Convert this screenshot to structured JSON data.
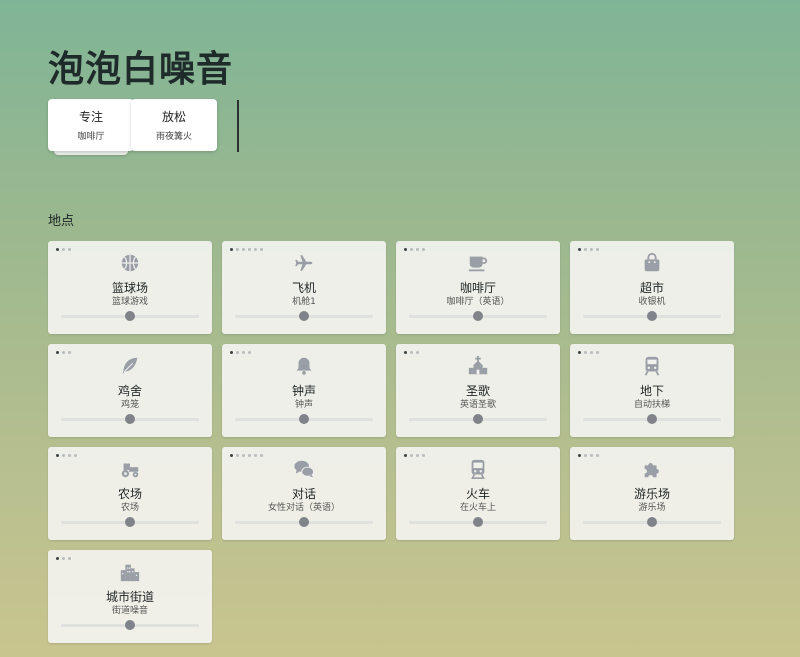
{
  "app": {
    "title": "泡泡白噪音"
  },
  "presets": [
    {
      "label": "专注",
      "sub": "咖啡厅"
    },
    {
      "label": "放松",
      "sub": "雨夜篝火"
    }
  ],
  "section": {
    "label": "地点"
  },
  "cards": [
    {
      "name": "篮球场",
      "sub": "篮球游戏",
      "icon": "basketball-icon",
      "dots": 3,
      "active_dot": 0,
      "volume": 0.5
    },
    {
      "name": "飞机",
      "sub": "机舱1",
      "icon": "airplane-icon",
      "dots": 6,
      "active_dot": 0,
      "volume": 0.5
    },
    {
      "name": "咖啡厅",
      "sub": "咖啡厅（英语）",
      "icon": "coffee-icon",
      "dots": 4,
      "active_dot": 0,
      "volume": 0.5
    },
    {
      "name": "超市",
      "sub": "收银机",
      "icon": "shopping-bag-icon",
      "dots": 4,
      "active_dot": 0,
      "volume": 0.5
    },
    {
      "name": "鸡舍",
      "sub": "鸡笼",
      "icon": "feather-icon",
      "dots": 3,
      "active_dot": 0,
      "volume": 0.5
    },
    {
      "name": "钟声",
      "sub": "钟声",
      "icon": "bell-icon",
      "dots": 4,
      "active_dot": 0,
      "volume": 0.5
    },
    {
      "name": "圣歌",
      "sub": "英语圣歌",
      "icon": "church-icon",
      "dots": 3,
      "active_dot": 0,
      "volume": 0.5
    },
    {
      "name": "地下",
      "sub": "自动扶梯",
      "icon": "subway-icon",
      "dots": 4,
      "active_dot": 0,
      "volume": 0.5
    },
    {
      "name": "农场",
      "sub": "农场",
      "icon": "tractor-icon",
      "dots": 4,
      "active_dot": 0,
      "volume": 0.5
    },
    {
      "name": "对话",
      "sub": "女性对话（英语）",
      "icon": "chat-icon",
      "dots": 6,
      "active_dot": 0,
      "volume": 0.5
    },
    {
      "name": "火车",
      "sub": "在火车上",
      "icon": "train-icon",
      "dots": 4,
      "active_dot": 0,
      "volume": 0.5
    },
    {
      "name": "游乐场",
      "sub": "游乐场",
      "icon": "puzzle-icon",
      "dots": 4,
      "active_dot": 0,
      "volume": 0.5
    },
    {
      "name": "城市街道",
      "sub": "街道噪音",
      "icon": "city-icon",
      "dots": 3,
      "active_dot": 0,
      "volume": 0.5
    }
  ]
}
